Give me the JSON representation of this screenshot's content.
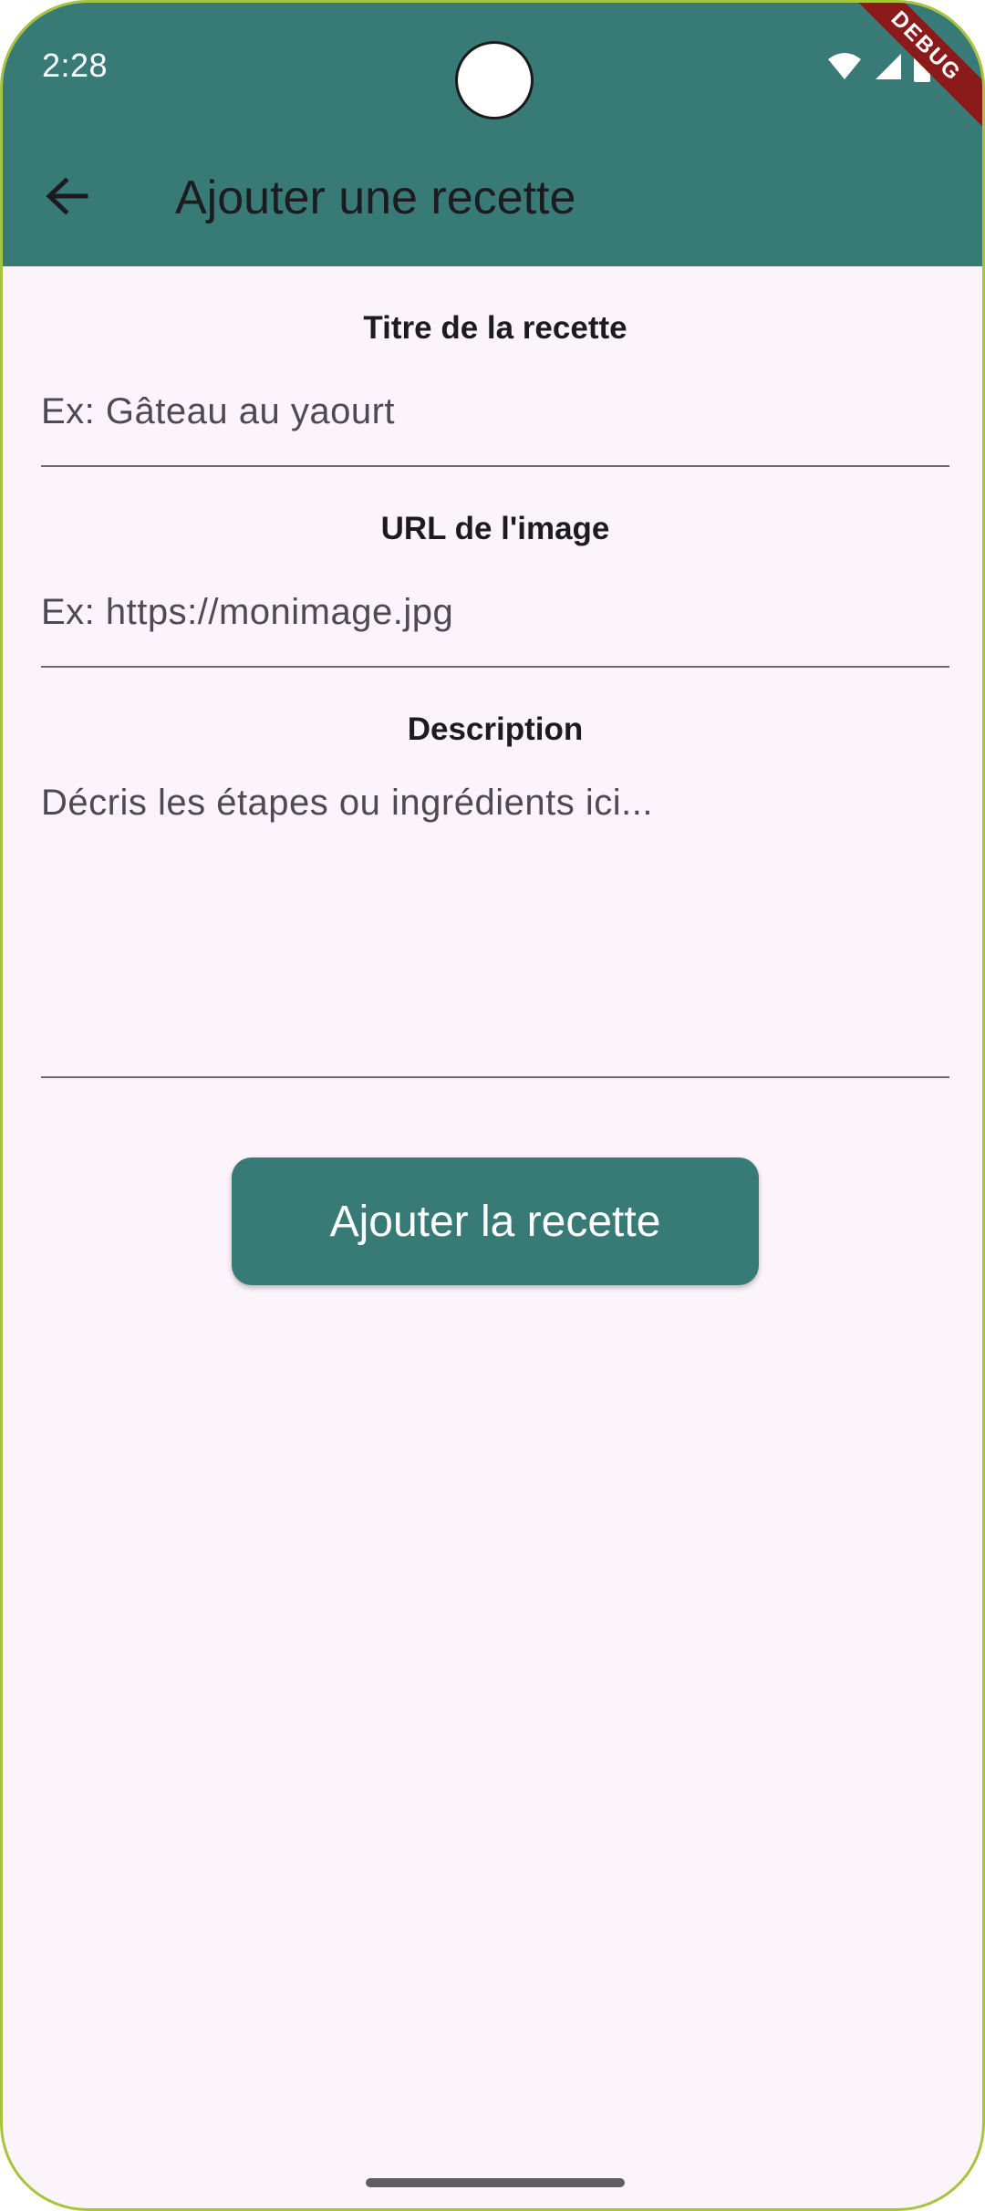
{
  "status_bar": {
    "time": "2:28",
    "icons": [
      "wifi-icon",
      "cellular-signal-icon",
      "battery-icon"
    ],
    "debug_label": "DEBUG"
  },
  "app_bar": {
    "back_icon": "arrow-left-icon",
    "title": "Ajouter une recette"
  },
  "form": {
    "title_label": "Titre de la recette",
    "title_placeholder": "Ex: Gâteau au yaourt",
    "title_value": "",
    "url_label": "URL de l'image",
    "url_placeholder": "Ex: https://monimage.jpg",
    "url_value": "",
    "description_label": "Description",
    "description_placeholder": "Décris les étapes ou ingrédients ici...",
    "description_value": "",
    "submit_label": "Ajouter la recette"
  },
  "colors": {
    "primary": "#387a76",
    "background": "#fcf4fb",
    "debug_ribbon": "#8b1a1a",
    "device_frame": "#a7c43c"
  }
}
